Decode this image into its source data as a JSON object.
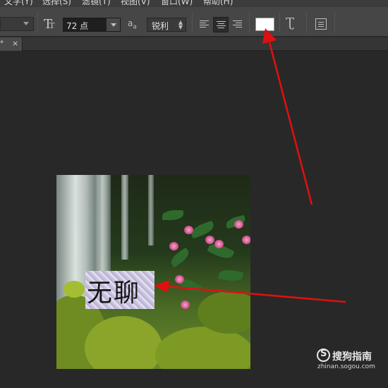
{
  "menu": {
    "items": [
      "文字(Y)",
      "选择(S)",
      "滤镜(T)",
      "视图(V)",
      "窗口(W)",
      "帮助(H)"
    ]
  },
  "options_bar": {
    "font_size_value": "72 点",
    "antialias_value": "锐利",
    "text_color": "#ffffff",
    "icons": [
      "text-orientation-icon",
      "font-size-icon",
      "antialias-icon",
      "align-left-icon",
      "align-center-icon",
      "align-right-icon",
      "warp-text-icon",
      "character-panel-icon"
    ]
  },
  "document_tab": {
    "title_suffix": "* ",
    "close": "×"
  },
  "canvas": {
    "text_layer": "无聊"
  },
  "annotations": {
    "arrow_color": "#e01010"
  },
  "watermark": {
    "brand": "搜狗指南",
    "url": "zhinan.sogou.com"
  }
}
